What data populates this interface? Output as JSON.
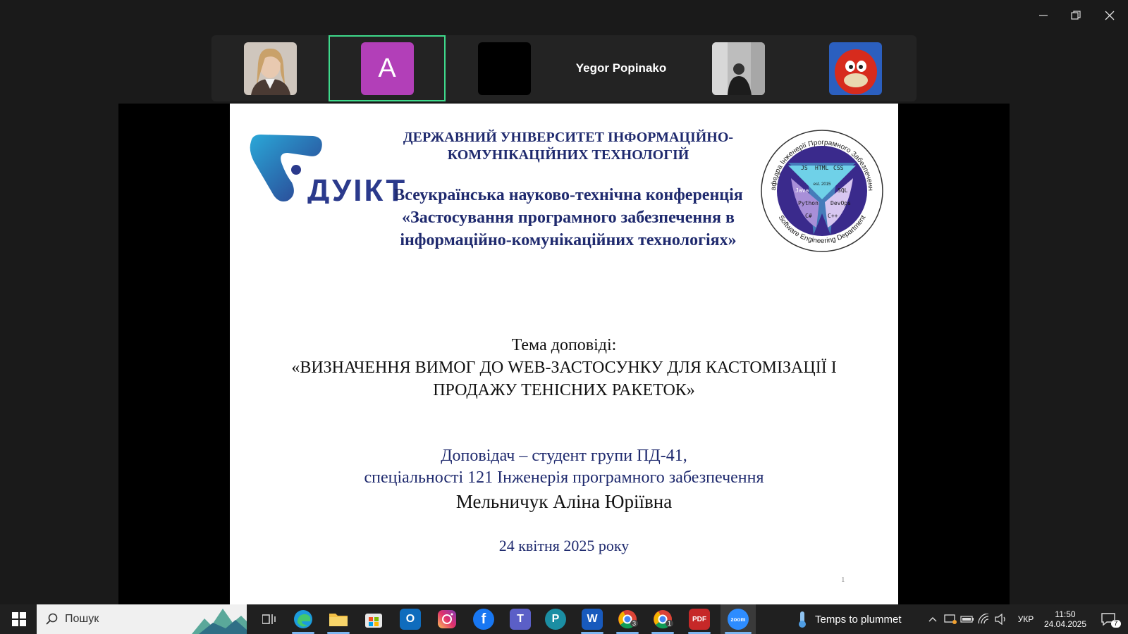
{
  "window": {
    "minimize_icon": "minimize-icon",
    "restore_icon": "restore-icon",
    "close_icon": "close-icon"
  },
  "participants": {
    "named_tile": "Yegor Popinako",
    "avatar_letter": "A",
    "active_border_color": "#3ed98b"
  },
  "slide": {
    "university": "ДЕРЖАВНИЙ УНІВЕРСИТЕТ ІНФОРМАЦІЙНО-КОМУНІКАЦІЙНИХ ТЕХНОЛОГІЙ",
    "logo_text": "ДУІКТ",
    "conference_line1": "Всеукраїнська науково-технічна конференція",
    "conference_line2": "«Застосування програмного забезпечення в інформаційно-комунікаційних технологіях»",
    "topic_label": "Тема доповіді:",
    "topic": "«ВИЗНАЧЕННЯ ВИМОГ ДО WEB-ЗАСТОСУНКУ ДЛЯ КАСТОМІЗАЦІЇ І ПРОДАЖУ ТЕНІСНИХ РАКЕТОК»",
    "speaker_line1": "Доповідач – студент групи ПД-41,",
    "speaker_line2": "спеціальності 121 Інженерія програмного забезпечення",
    "speaker_name": "Мельничук Аліна Юріївна",
    "date": "24 квітня 2025 року",
    "page_number": "1",
    "seal": {
      "outer_top": "Кафедра Інженерії Програмного Забезпечення",
      "outer_bottom": "Software Engineering Department",
      "labels": [
        "JS",
        "HTML",
        "CSS",
        "Java",
        "SQL",
        "Python",
        "DevOps",
        "C#",
        "C++"
      ],
      "est": "est. 2015"
    },
    "accent_color": "#1f2a6e"
  },
  "taskbar": {
    "search_placeholder": "Пошук",
    "weather_text": "Temps to plummet",
    "language": "УКР",
    "time": "11:50",
    "date": "24.04.2025",
    "notification_count": "7",
    "chrome_badge_1": "3",
    "chrome_badge_2": "1",
    "zoom_label": "zoom"
  }
}
